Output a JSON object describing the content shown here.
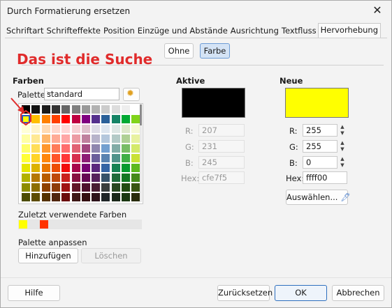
{
  "window": {
    "title": "Durch Formatierung ersetzen",
    "close_icon": "close-icon"
  },
  "tabs": [
    {
      "label": "Schriftart"
    },
    {
      "label": "Schrifteffekte"
    },
    {
      "label": "Position"
    },
    {
      "label": "Einzüge und Abstände"
    },
    {
      "label": "Ausrichtung"
    },
    {
      "label": "Textfluss"
    },
    {
      "label": "Hervorhebung",
      "active": true
    }
  ],
  "toggle": {
    "none_label": "Ohne",
    "color_label": "Farbe",
    "selected": "Farbe"
  },
  "annotation": {
    "text": "Das ist die Suche",
    "color": "#e02b2b"
  },
  "colors_section": {
    "heading": "Farben",
    "palette_label": "Palette:",
    "palette_value": "standard",
    "recent_heading": "Zuletzt verwendete Farben",
    "recent_colors": [
      "#ffff00",
      "#ff3300"
    ],
    "customize_heading": "Palette anpassen",
    "add_button": "Hinzufügen",
    "delete_button": "Löschen"
  },
  "palette": [
    [
      "#000000",
      "#111111",
      "#1c1c1c",
      "#333333",
      "#666666",
      "#808080",
      "#999999",
      "#b2b2b2",
      "#cccccc",
      "#dddddd",
      "#eeeeee",
      "#ffffff"
    ],
    [
      "#ffff00",
      "#ffbf00",
      "#ff8000",
      "#ff4000",
      "#ff0000",
      "#bf0041",
      "#800080",
      "#55308d",
      "#2a6099",
      "#158466",
      "#00a933",
      "#81d41a"
    ],
    [
      "#ffffd7",
      "#fff5ce",
      "#ffdbb6",
      "#ffd8ce",
      "#ffd7d7",
      "#f7d1d5",
      "#e0c2cd",
      "#dedce6",
      "#dee6ef",
      "#dee7e5",
      "#dde8cb",
      "#f6f9d4"
    ],
    [
      "#ffffa6",
      "#ffe994",
      "#ffb66c",
      "#ffaa95",
      "#ffa6a6",
      "#ec9ba4",
      "#bf819e",
      "#b7b3ca",
      "#b4c7dc",
      "#b3cac7",
      "#afd095",
      "#e8f2a1"
    ],
    [
      "#ffff6d",
      "#ffde59",
      "#ff972f",
      "#ff7b59",
      "#ff6d6d",
      "#e16173",
      "#a1467e",
      "#8e86ae",
      "#729fcf",
      "#81aca6",
      "#77bc65",
      "#d4ea6b"
    ],
    [
      "#ffff38",
      "#ffd428",
      "#ff860d",
      "#ff5429",
      "#ff3838",
      "#d62e4e",
      "#8d1d75",
      "#6b5e9b",
      "#5983b0",
      "#50938a",
      "#3faf46",
      "#c9e135"
    ],
    [
      "#e6e600",
      "#dcb200",
      "#ea7500",
      "#ed4c05",
      "#f10d0c",
      "#a7074b",
      "#780373",
      "#5b277d",
      "#3465a4",
      "#168253",
      "#069a2e",
      "#5eb91e"
    ],
    [
      "#b2b200",
      "#b47804",
      "#b85c00",
      "#be480a",
      "#c9211e",
      "#861141",
      "#650953",
      "#55215b",
      "#355269",
      "#1e6a39",
      "#127622",
      "#468a1a"
    ],
    [
      "#8d8d00",
      "#8c6e00",
      "#8d4100",
      "#8e3c07",
      "#a01313",
      "#611729",
      "#4e102d",
      "#481d32",
      "#383d3c",
      "#28471f",
      "#224b12",
      "#395511"
    ],
    [
      "#4c4c00",
      "#5d4c00",
      "#553200",
      "#50260d",
      "#6a0a0a",
      "#3d1715",
      "#330e10",
      "#2c1219",
      "#1f2527",
      "#1a2819",
      "#1a3711",
      "#282b09"
    ]
  ],
  "active": {
    "heading": "Aktive",
    "preview_color": "#000000",
    "r_label": "R:",
    "r_value": "207",
    "g_label": "G:",
    "g_value": "231",
    "b_label": "B:",
    "b_value": "245",
    "hex_label": "Hex:",
    "hex_value": "cfe7f5"
  },
  "new": {
    "heading": "Neue",
    "preview_color": "#ffff00",
    "r_label": "R:",
    "r_value": "255",
    "g_label": "G:",
    "g_value": "255",
    "b_label": "B:",
    "b_value": "0",
    "hex_label": "Hex:",
    "hex_value": "ffff00",
    "pick_button": "Auswählen..."
  },
  "footer": {
    "help": "Hilfe",
    "reset": "Zurücksetzen",
    "ok": "OK",
    "cancel": "Abbrechen"
  }
}
